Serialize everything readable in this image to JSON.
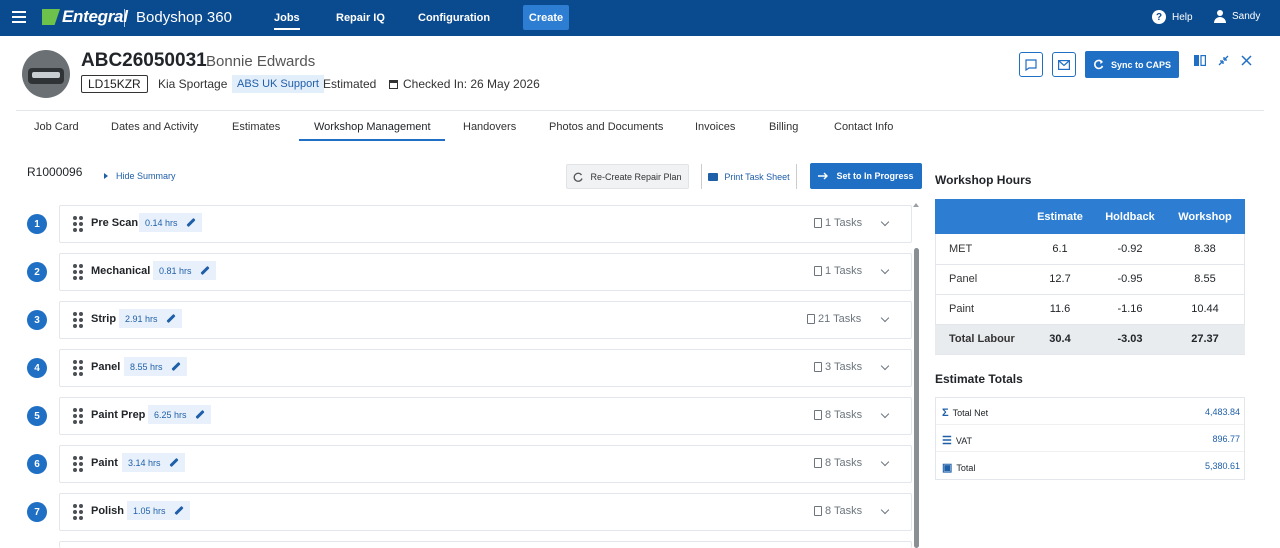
{
  "topbar": {
    "brand": "Entegral",
    "app_name": "Bodyshop 360",
    "nav": [
      "Jobs",
      "Repair IQ",
      "Configuration"
    ],
    "create_label": "Create",
    "help_label": "Help",
    "user_name": "Sandy"
  },
  "job": {
    "number": "ABC26050031",
    "customer": "Bonnie Edwards",
    "registration": "LD15KZR",
    "vehicle": "Kia Sportage",
    "insurer": "ABS UK Support",
    "status": "Estimated",
    "checked_in": "Checked In: 26 May 2026",
    "sync_label": "Sync to CAPS"
  },
  "tabs": [
    "Job Card",
    "Dates and Activity",
    "Estimates",
    "Workshop Management",
    "Handovers",
    "Photos and Documents",
    "Invoices",
    "Billing",
    "Contact Info"
  ],
  "active_tab": "Workshop Management",
  "plan": {
    "repair_no": "R1000096",
    "hide_summary": "Hide Summary",
    "recreate_label": "Re-Create Repair Plan",
    "print_label": "Print Task Sheet",
    "set_progress_label": "Set to In Progress",
    "stages": [
      {
        "num": "1",
        "name": "Pre Scan",
        "hrs": "0.14 hrs",
        "tasks": "1 Tasks"
      },
      {
        "num": "2",
        "name": "Mechanical",
        "hrs": "0.81 hrs",
        "tasks": "1 Tasks"
      },
      {
        "num": "3",
        "name": "Strip",
        "hrs": "2.91 hrs",
        "tasks": "21 Tasks"
      },
      {
        "num": "4",
        "name": "Panel",
        "hrs": "8.55 hrs",
        "tasks": "3 Tasks"
      },
      {
        "num": "5",
        "name": "Paint Prep",
        "hrs": "6.25 hrs",
        "tasks": "8 Tasks"
      },
      {
        "num": "6",
        "name": "Paint",
        "hrs": "3.14 hrs",
        "tasks": "8 Tasks"
      },
      {
        "num": "7",
        "name": "Polish",
        "hrs": "1.05 hrs",
        "tasks": "8 Tasks"
      }
    ]
  },
  "workshop_hours": {
    "title": "Workshop Hours",
    "columns": [
      "",
      "Estimate",
      "Holdback",
      "Workshop"
    ],
    "rows": [
      [
        "MET",
        "6.1",
        "-0.92",
        "8.38"
      ],
      [
        "Panel",
        "12.7",
        "-0.95",
        "8.55"
      ],
      [
        "Paint",
        "11.6",
        "-1.16",
        "10.44"
      ],
      [
        "Total Labour",
        "30.4",
        "-3.03",
        "27.37"
      ]
    ]
  },
  "estimate_totals": {
    "title": "Estimate Totals",
    "rows": [
      {
        "label": "Total Net",
        "value": "4,483.84",
        "icon": "sigma-icon"
      },
      {
        "label": "VAT",
        "value": "896.77",
        "icon": "receipt-icon"
      },
      {
        "label": "Total",
        "value": "5,380.61",
        "icon": "cash-icon"
      }
    ]
  }
}
